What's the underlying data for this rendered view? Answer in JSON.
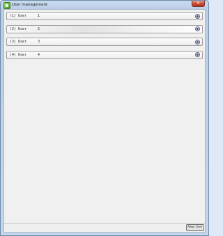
{
  "window": {
    "title": "User management",
    "close_label": "✕"
  },
  "users": [
    {
      "label": "(1) User",
      "number": "1"
    },
    {
      "label": "(2) User",
      "number": "2"
    },
    {
      "label": "(3) User",
      "number": "3"
    },
    {
      "label": "(4) User",
      "number": "4"
    }
  ],
  "footer": {
    "new_user_label": "New User"
  },
  "icons": {
    "app": "app-icon",
    "row_action": "settings-icon",
    "close": "close-icon"
  },
  "colors": {
    "titlebar": "#b9cde6",
    "client_bg": "#f0f0f0",
    "close_button": "#c8472f"
  }
}
